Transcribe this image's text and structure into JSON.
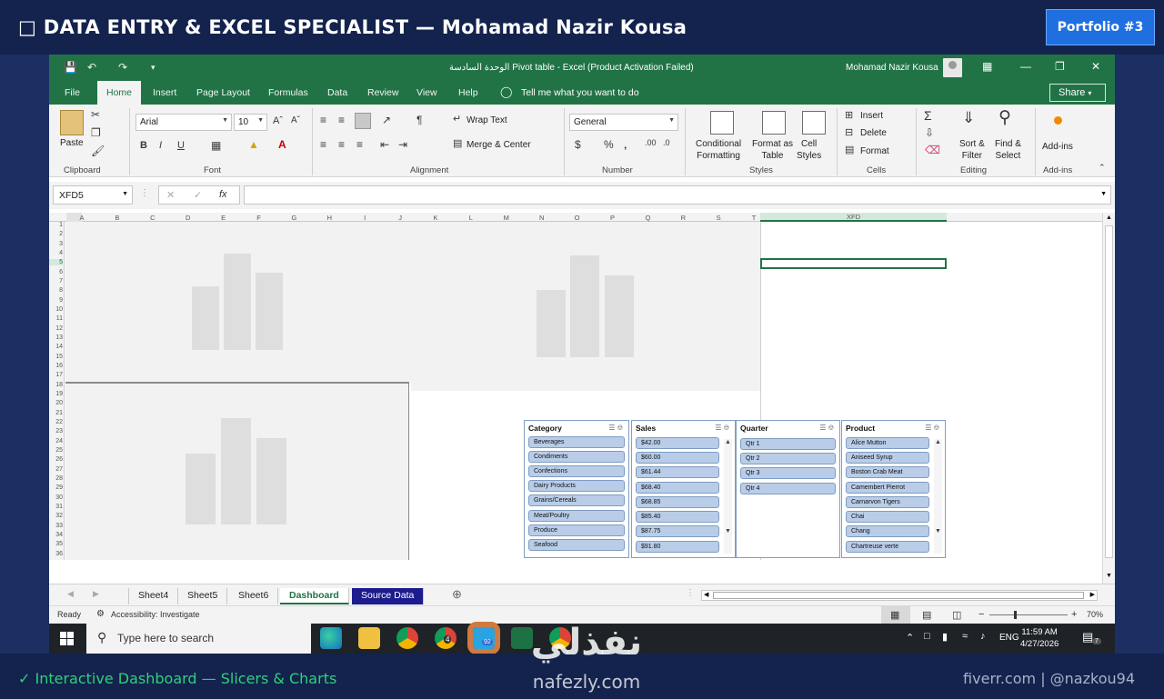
{
  "banner": {
    "title": "□ DATA ENTRY & EXCEL SPECIALIST — Mohamad Nazir Kousa",
    "portfolio_label": "Portfolio #3"
  },
  "excel": {
    "doc_title": "الوحدة السادسة Pivot table  -  Excel (Product Activation Failed)",
    "user_name": "Mohamad Nazir Kousa",
    "ribbon_tabs": [
      "File",
      "Home",
      "Insert",
      "Page Layout",
      "Formulas",
      "Data",
      "Review",
      "View",
      "Help"
    ],
    "active_tab": "Home",
    "tell_me": "Tell me what you want to do",
    "share_label": "Share",
    "ribbon": {
      "clipboard": {
        "paste": "Paste",
        "label": "Clipboard"
      },
      "font": {
        "name": "Arial",
        "size": "10",
        "label": "Font"
      },
      "alignment": {
        "wrap_text": "Wrap Text",
        "merge_center": "Merge & Center",
        "label": "Alignment"
      },
      "number": {
        "format": "General",
        "label": "Number"
      },
      "styles": {
        "conditional": "Conditional",
        "conditional2": "Formatting",
        "format_as": "Format as",
        "format_as2": "Table",
        "cell": "Cell",
        "cell2": "Styles",
        "label": "Styles"
      },
      "cells": {
        "insert": "Insert",
        "delete": "Delete",
        "format": "Format",
        "label": "Cells"
      },
      "editing": {
        "sort": "Sort &",
        "sort2": "Filter",
        "find": "Find &",
        "find2": "Select",
        "label": "Editing"
      },
      "addins": {
        "addins": "Add-ins",
        "label": "Add-ins"
      }
    },
    "name_box": "XFD5",
    "columns": [
      "A",
      "B",
      "C",
      "D",
      "E",
      "F",
      "G",
      "H",
      "I",
      "J",
      "K",
      "L",
      "M",
      "N",
      "O",
      "P",
      "Q",
      "R",
      "S",
      "T"
    ],
    "last_column": "XFD",
    "rows": [
      "1",
      "2",
      "3",
      "4",
      "5",
      "6",
      "7",
      "8",
      "9",
      "10",
      "11",
      "12",
      "13",
      "14",
      "15",
      "16",
      "17",
      "18",
      "19",
      "20",
      "21",
      "22",
      "23",
      "24",
      "25",
      "26",
      "27",
      "28",
      "29",
      "30",
      "31",
      "32",
      "33",
      "34",
      "35",
      "36"
    ],
    "slicers": [
      {
        "title": "Category",
        "items": [
          "Beverages",
          "Condiments",
          "Confections",
          "Dairy Products",
          "Grains/Cereals",
          "Meat/Poultry",
          "Produce",
          "Seafood"
        ]
      },
      {
        "title": "Sales",
        "items": [
          "$42.00",
          "$60.00",
          "$61.44",
          "$68.40",
          "$68.85",
          "$85.40",
          "$87.75",
          "$91.80"
        ]
      },
      {
        "title": "Quarter",
        "items": [
          "Qtr 1",
          "Qtr 2",
          "Qtr 3",
          "Qtr 4"
        ]
      },
      {
        "title": "Product",
        "items": [
          "Alice Mutton",
          "Aniseed Syrup",
          "Boston Crab Meat",
          "Camembert Pierrot",
          "Carnarvon Tigers",
          "Chai",
          "Chang",
          "Chartreuse verte"
        ]
      }
    ],
    "sheet_tabs": [
      "Sheet4",
      "Sheet5",
      "Sheet6",
      "Dashboard",
      "Source Data"
    ],
    "active_sheet": "Dashboard",
    "status": {
      "ready": "Ready",
      "accessibility": "Accessibility: Investigate",
      "zoom": "70%"
    }
  },
  "taskbar": {
    "search_placeholder": "Type here to search",
    "language": "ENG",
    "time": "11:59 AM",
    "date": "4/27/2026",
    "badge_notifications": "7",
    "badge_chrome2": "4",
    "badge_telegram": "92"
  },
  "watermark": {
    "arabic": "نفذلي",
    "latin": "nafezly.com"
  },
  "footer": {
    "left": "✓ Interactive Dashboard — Slicers & Charts",
    "right": "fiverr.com | @nazkou94"
  },
  "colors": {
    "excel_green": "#217346",
    "banner_bg": "#13234d",
    "page_bg": "#1c2f63",
    "slicer_item": "#b9cde8",
    "portfolio_button": "#1f6fe0",
    "footer_accent": "#2fd07a"
  }
}
